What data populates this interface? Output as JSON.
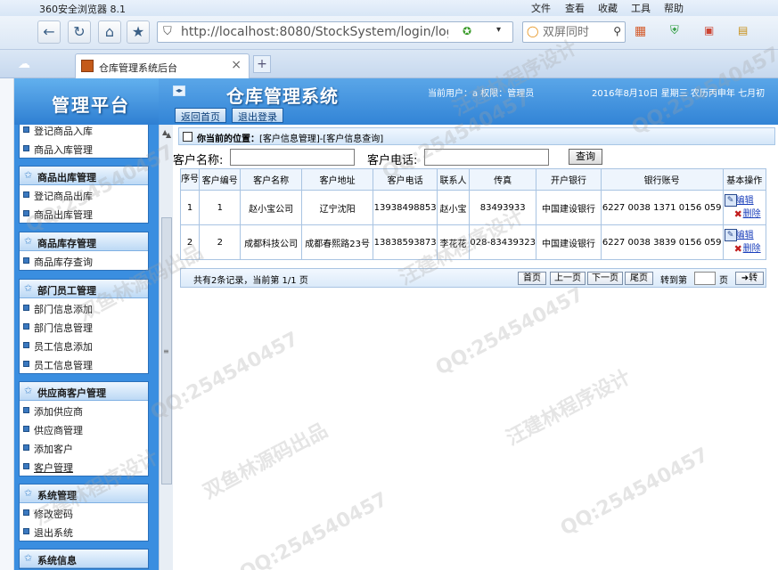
{
  "browser": {
    "title": "360安全浏览器 8.1",
    "menu": [
      "文件",
      "查看",
      "收藏",
      "工具",
      "帮助"
    ],
    "url": "http://localhost:8080/StockSystem/login/logir",
    "search_placeholder": "双屏同时",
    "tab_label": "仓库管理系统后台",
    "tab_close": "×",
    "newtab": "+"
  },
  "header": {
    "logo": "管理平台",
    "title": "仓库管理系统",
    "current_user": "当前用户：a 权限：管理员",
    "date": "2016年8月10日 星期三 农历丙申年 七月初",
    "home_btn": "返回首页",
    "logout_btn": "退出登录"
  },
  "sidebar": {
    "group0": {
      "items": [
        "登记商品入库",
        "商品入库管理"
      ]
    },
    "group1": {
      "title": "商品出库管理",
      "items": [
        "登记商品出库",
        "商品出库管理"
      ]
    },
    "group2": {
      "title": "商品库存管理",
      "items": [
        "商品库存查询"
      ]
    },
    "group3": {
      "title": "部门员工管理",
      "items": [
        "部门信息添加",
        "部门信息管理",
        "员工信息添加",
        "员工信息管理"
      ]
    },
    "group4": {
      "title": "供应商客户管理",
      "items": [
        "添加供应商",
        "供应商管理",
        "添加客户",
        "客户管理"
      ]
    },
    "group5": {
      "title": "系统管理",
      "items": [
        "修改密码",
        "退出系统"
      ]
    },
    "group6": {
      "title": "系统信息"
    }
  },
  "location": {
    "label": "你当前的位置：",
    "path": "[客户信息管理]-[客户信息查询]"
  },
  "search": {
    "name_label": "客户名称:",
    "phone_label": "客户电话:",
    "query_btn": "查询"
  },
  "table": {
    "headers": [
      "序号",
      "客户编号",
      "客户名称",
      "客户地址",
      "客户电话",
      "联系人",
      "传真",
      "开户银行",
      "银行账号",
      "基本操作"
    ],
    "rows": [
      [
        "1",
        "1",
        "赵小宝公司",
        "辽宁沈阳",
        "13938498853",
        "赵小宝",
        "83493933",
        "中国建设银行",
        "6227 0038 1371 0156 059"
      ],
      [
        "2",
        "2",
        "成都科技公司",
        "成都春熙路23号",
        "13838593873",
        "李花花",
        "028-83439323",
        "中国建设银行",
        "6227 0038 3839 0156 059"
      ]
    ],
    "edit_label": "编辑",
    "delete_label": "删除"
  },
  "pager": {
    "summary": "共有2条记录，当前第 1/1 页",
    "first": "首页",
    "prev": "上一页",
    "next": "下一页",
    "last": "尾页",
    "goto_label": "转到第",
    "page_unit": "页",
    "go_btn": "➜转"
  },
  "watermarks": [
    "QQ:254540457",
    "汪建林程序设计",
    "双鱼林源码出品"
  ],
  "colors": {
    "header_blue": "#3a8ee0",
    "border": "#a9c4e2"
  }
}
